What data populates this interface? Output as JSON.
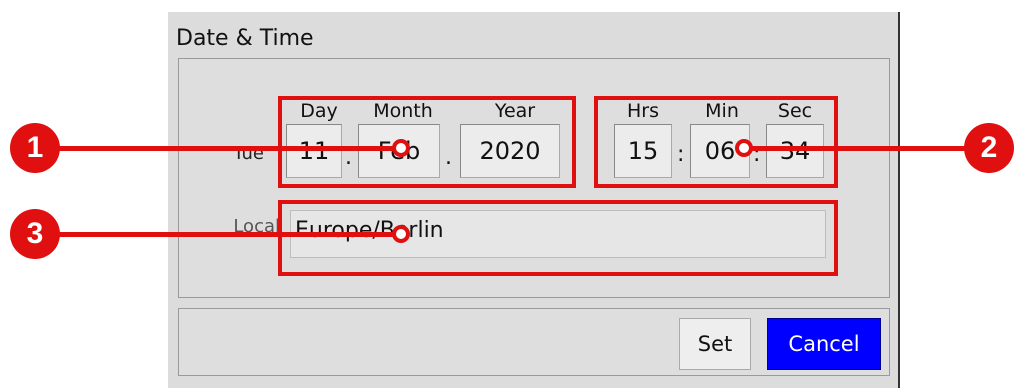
{
  "dialog": {
    "title": "Date & Time",
    "date": {
      "row_label": "Tue",
      "day": {
        "label": "Day",
        "value": "11"
      },
      "month": {
        "label": "Month",
        "value": "Feb"
      },
      "year": {
        "label": "Year",
        "value": "2020"
      },
      "separator": "."
    },
    "time": {
      "hrs": {
        "label": "Hrs",
        "value": "15"
      },
      "min": {
        "label": "Min",
        "value": "06"
      },
      "sec": {
        "label": "Sec",
        "value": "34"
      },
      "separator_1": ":",
      "separator_2": ":"
    },
    "locale": {
      "row_label": "Local",
      "value": "Europe/Berlin"
    },
    "buttons": {
      "set": "Set",
      "cancel": "Cancel"
    }
  },
  "callouts": [
    "1",
    "2",
    "3"
  ],
  "colors": {
    "annotation_red": "#e01010",
    "cancel_blue": "#0000ff",
    "dialog_bg": "#dcdcdc"
  }
}
